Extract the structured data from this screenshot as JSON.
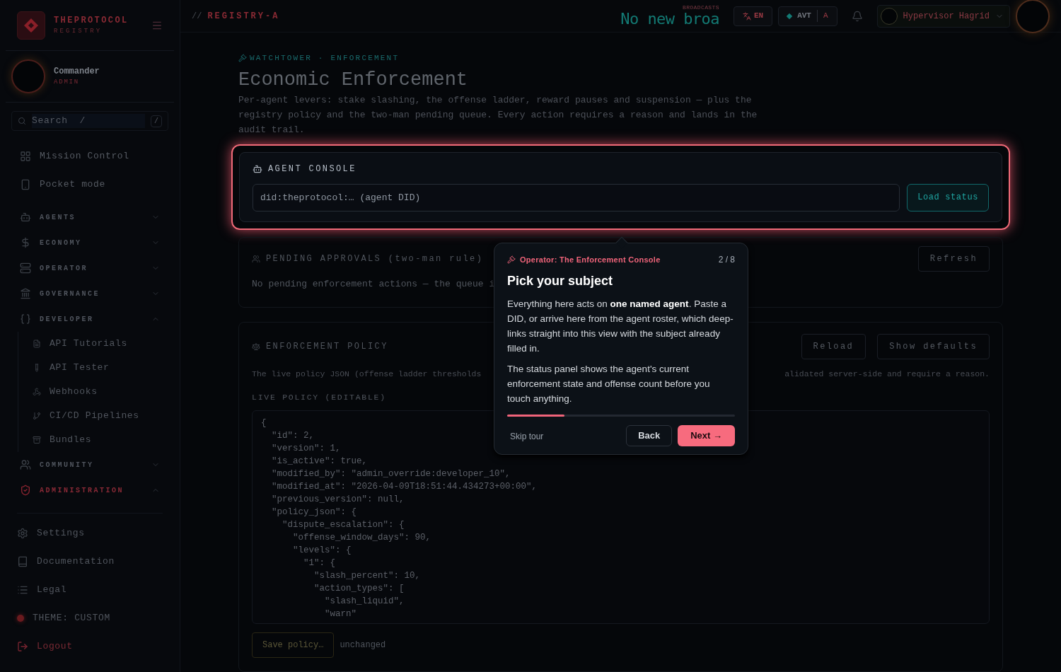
{
  "brand": {
    "name": "THEPROTOCOL",
    "sub": "REGISTRY"
  },
  "user": {
    "name": "Commander",
    "role": "ADMIN"
  },
  "search": {
    "placeholder": "Search  /",
    "shortcut": "/"
  },
  "nav_top": [
    {
      "label": "Mission Control"
    },
    {
      "label": "Pocket mode"
    }
  ],
  "nav_groups": [
    {
      "label": "AGENTS",
      "expanded": false,
      "active": false
    },
    {
      "label": "ECONOMY",
      "expanded": false,
      "active": false
    },
    {
      "label": "OPERATOR",
      "expanded": false,
      "active": false
    },
    {
      "label": "GOVERNANCE",
      "expanded": false,
      "active": false
    },
    {
      "label": "DEVELOPER",
      "expanded": true,
      "active": false,
      "children": [
        {
          "label": "API Tutorials"
        },
        {
          "label": "API Tester"
        },
        {
          "label": "Webhooks"
        },
        {
          "label": "CI/CD Pipelines"
        },
        {
          "label": "Bundles"
        }
      ]
    },
    {
      "label": "COMMUNITY",
      "expanded": false,
      "active": false
    },
    {
      "label": "ADMINISTRATION",
      "expanded": true,
      "active": true
    }
  ],
  "nav_bottom": [
    {
      "label": "Settings",
      "kind": "link"
    },
    {
      "label": "Documentation",
      "kind": "link"
    },
    {
      "label": "Legal",
      "kind": "link"
    },
    {
      "label": "THEME: CUSTOM",
      "kind": "theme"
    },
    {
      "label": "Logout",
      "kind": "danger"
    }
  ],
  "topbar": {
    "breadcrumb_prefix": "//",
    "breadcrumb": "REGISTRY-A",
    "ticker": "No new broa",
    "ticker_label": "BROADCASTS",
    "language": "EN",
    "token": "AVT",
    "token_letter": "A",
    "account": "Hypervisor Hagrid"
  },
  "page": {
    "eyebrow": "WATCHTOWER · ENFORCEMENT",
    "title": "Economic Enforcement",
    "description": "Per-agent levers: stake slashing, the offense ladder, reward pauses and suspension — plus the registry policy and the two-man pending queue. Every action requires a reason and lands in the audit trail."
  },
  "agent_console": {
    "title": "AGENT CONSOLE",
    "placeholder": "did:theprotocol:… (agent DID)",
    "button": "Load status"
  },
  "pending": {
    "title": "PENDING APPROVALS (two-man rule)",
    "button": "Refresh",
    "empty": "No pending enforcement actions — the queue i"
  },
  "policy": {
    "title": "ENFORCEMENT POLICY",
    "buttons": [
      "Reload",
      "Show defaults"
    ],
    "note_left": "The live policy JSON (offense ladder thresholds",
    "note_right": "alidated server-side and require a reason.",
    "editor_label": "LIVE POLICY (EDITABLE)",
    "code": [
      "{",
      "  \"id\": 2,",
      "  \"version\": 1,",
      "  \"is_active\": true,",
      "  \"modified_by\": \"admin_override:developer_10\",",
      "  \"modified_at\": \"2026-04-09T18:51:44.434273+00:00\",",
      "  \"previous_version\": null,",
      "  \"policy_json\": {",
      "    \"dispute_escalation\": {",
      "      \"offense_window_days\": 90,",
      "      \"levels\": {",
      "        \"1\": {",
      "          \"slash_percent\": 10,",
      "          \"action_types\": [",
      "            \"slash_liquid\",",
      "            \"warn\""
    ],
    "save_button": "Save policy…",
    "save_state": "unchanged"
  },
  "tour": {
    "eyebrow": "Operator: The Enforcement Console",
    "step": "2 / 8",
    "title": "Pick your subject",
    "paragraphs": [
      "Everything here acts on **one named agent**. Paste a DID, or arrive here from the agent roster, which deep-links straight into this view with the subject already filled in.",
      "The status panel shows the agent's current enforcement state and offense count before you touch anything."
    ],
    "level": 0.25,
    "skip": "Skip tour",
    "back": "Back",
    "next": "Next →"
  }
}
